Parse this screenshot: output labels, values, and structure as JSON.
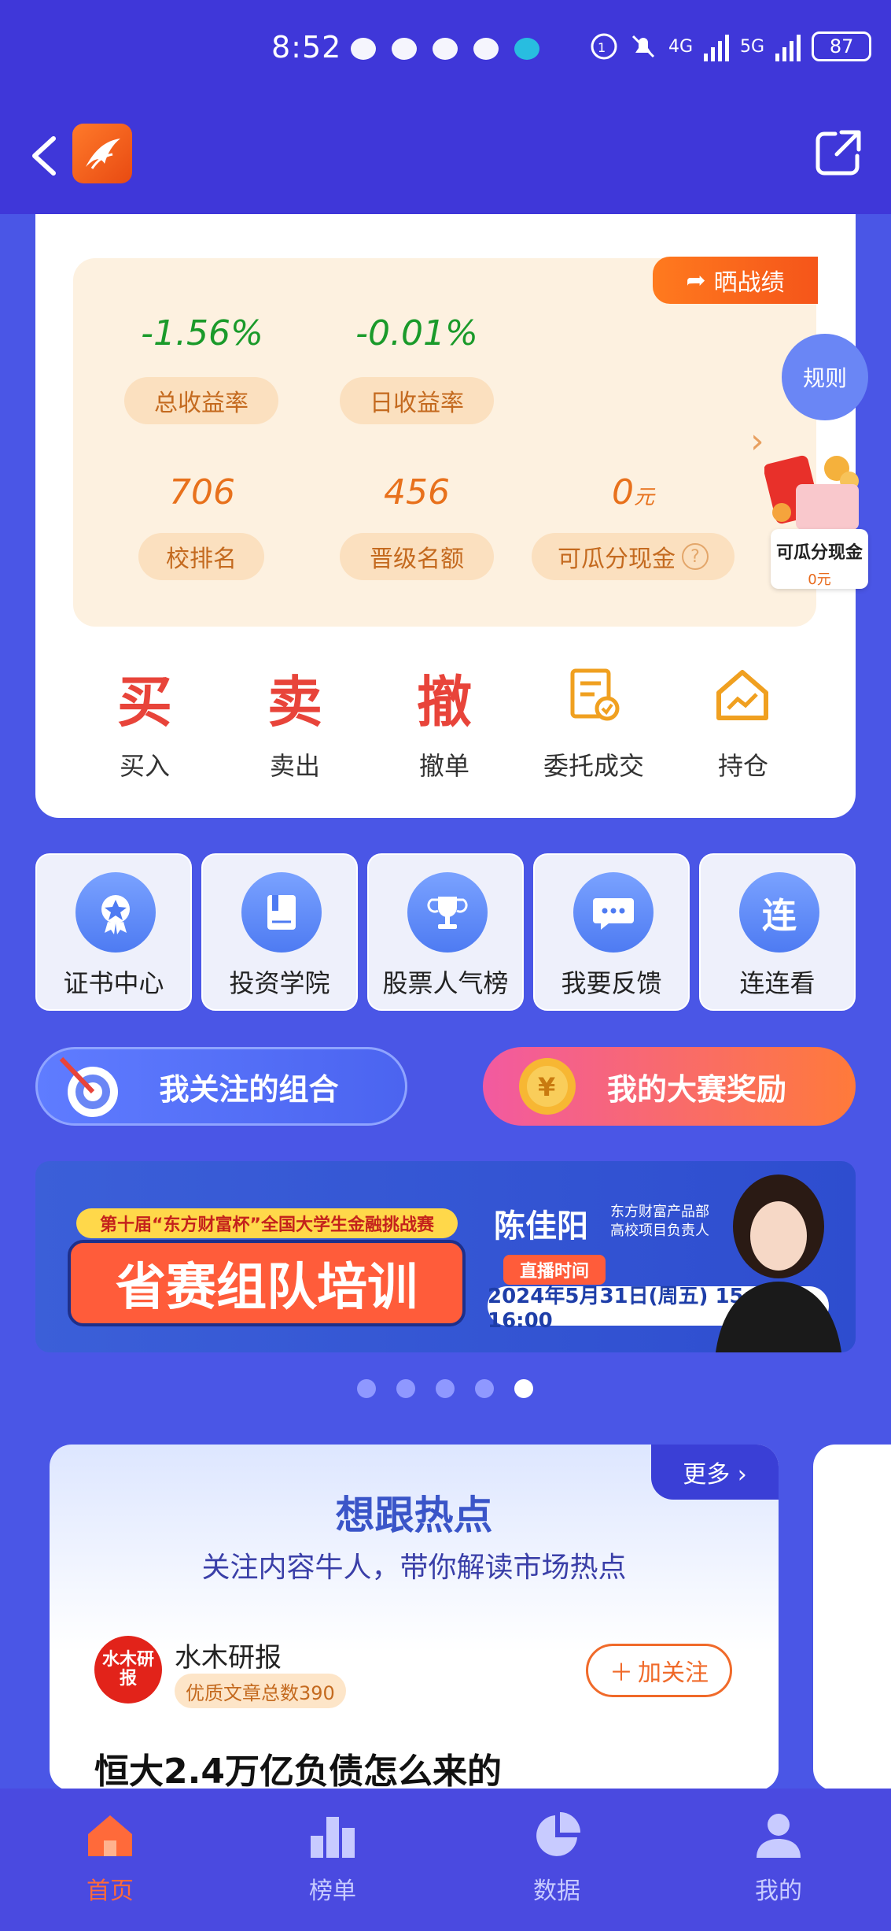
{
  "status_bar": {
    "time": "8:52",
    "network_4g": "4G",
    "network_5g": "5G",
    "battery": "87"
  },
  "header": {
    "back_icon": "chevron-left-icon",
    "app_icon": "eastmoney-logo-icon",
    "share_icon": "external-link-icon"
  },
  "stats": {
    "share_label": "晒战绩",
    "total_return": {
      "value": "-1.56%",
      "label": "总收益率"
    },
    "daily_return": {
      "value": "-0.01%",
      "label": "日收益率"
    },
    "school_rank": {
      "value": "706",
      "label": "校排名"
    },
    "promotion_quota": {
      "value": "456",
      "label": "晋级名额"
    },
    "cash_share": {
      "value": "0",
      "unit": "元",
      "label": "可瓜分现金"
    }
  },
  "float_widgets": {
    "rules_label": "规则",
    "cash_title": "可瓜分现金",
    "cash_value": "0元"
  },
  "trade_actions": [
    {
      "glyph": "买",
      "label": "买入"
    },
    {
      "glyph": "卖",
      "label": "卖出"
    },
    {
      "glyph": "撤",
      "label": "撤单"
    },
    {
      "glyph": "",
      "label": "委托成交"
    },
    {
      "glyph": "",
      "label": "持仓"
    }
  ],
  "tiles": [
    {
      "label": "证书中心",
      "icon": "certificate-icon"
    },
    {
      "label": "投资学院",
      "icon": "book-icon"
    },
    {
      "label": "股票人气榜",
      "icon": "trophy-icon"
    },
    {
      "label": "我要反馈",
      "icon": "chat-icon"
    },
    {
      "label": "连连看",
      "icon": "link-game-icon"
    }
  ],
  "banner_buttons": {
    "my_follow": "我关注的组合",
    "my_rewards": "我的大赛奖励"
  },
  "promo": {
    "subtitle": "第十届“东方财富杯”全国大学生金融挑战赛",
    "title": "省赛组队培训",
    "speaker": "陈佳阳",
    "role_line1": "东方财富产品部",
    "role_line2": "高校项目负责人",
    "live_label": "直播时间",
    "time": "2024年5月31日(周五) 15:00-16:00"
  },
  "carousel": {
    "count": 5,
    "active_index": 4
  },
  "hot": {
    "more_label": "更多 ›",
    "title": "想跟热点",
    "subtitle": "关注内容牛人，带你解读市场热点",
    "avatar_text": "水木研报",
    "author": "水木研报",
    "badge": "优质文章总数390",
    "follow_label": "加关注",
    "article_title": "恒大2.4万亿负债怎么来的"
  },
  "tabbar": [
    {
      "label": "首页",
      "icon": "home-icon",
      "active": true
    },
    {
      "label": "榜单",
      "icon": "ranking-icon",
      "active": false
    },
    {
      "label": "数据",
      "icon": "pie-chart-icon",
      "active": false
    },
    {
      "label": "我的",
      "icon": "user-icon",
      "active": false
    }
  ],
  "colors": {
    "primary": "#3f37d9",
    "accent": "#ff6a3a",
    "positive_green": "#1a9a2a",
    "orange": "#e8711c"
  }
}
